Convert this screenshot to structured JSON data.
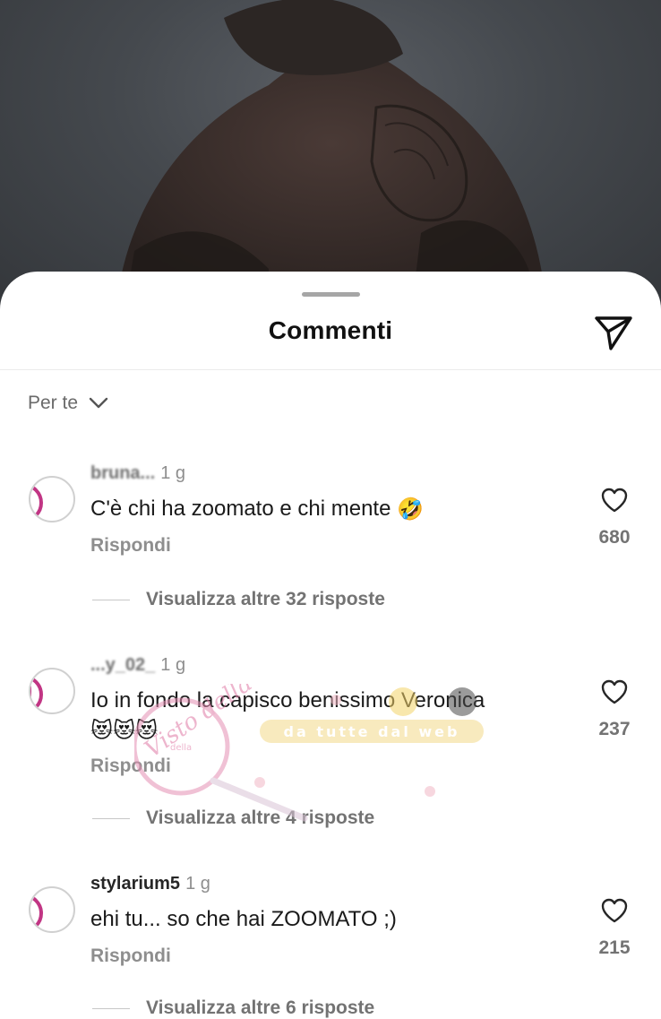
{
  "sheet": {
    "title": "Commenti",
    "filter_label": "Per te"
  },
  "comments": [
    {
      "username": "bruna...",
      "time": "1 g",
      "text": "C'è chi ha zoomato e chi mente",
      "emoji": "🤣",
      "reply_label": "Rispondi",
      "likes": "680",
      "more_label": "Visualizza altre 32 risposte"
    },
    {
      "username": "...y_02_",
      "time": "1 g",
      "text": "Io in fondo la capisco benissimo Veronica",
      "emoji": "😻😻😻",
      "reply_label": "Rispondi",
      "likes": "237",
      "more_label": "Visualizza altre 4 risposte"
    },
    {
      "username": "stylarium5",
      "time": "1 g",
      "text": "ehi tu... so che hai ZOOMATO ;)",
      "emoji": "",
      "reply_label": "Rispondi",
      "likes": "215",
      "more_label": "Visualizza altre 6 risposte"
    }
  ],
  "watermark": {
    "script": "Visto della News",
    "small": "della",
    "band": "da tutte dal web"
  },
  "icons": {
    "send": "paper-plane-icon",
    "like": "heart-icon",
    "filter": "chevron-down-icon"
  },
  "colors": {
    "accent_ring": "#c13584",
    "text_primary": "#1a1a1a",
    "text_secondary": "#737373"
  }
}
